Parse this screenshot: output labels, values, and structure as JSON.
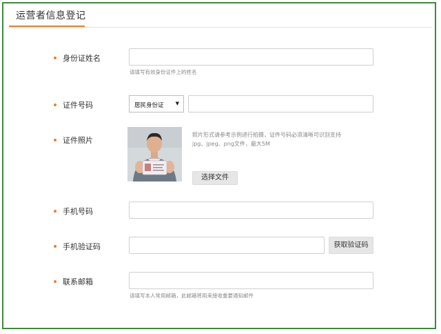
{
  "page": {
    "title": "运营者信息登记"
  },
  "colors": {
    "accent": "#e8802b",
    "frame": "#3b8a3b"
  },
  "form": {
    "id_name": {
      "label": "身份证姓名",
      "value": "",
      "hint": "请填写有效身份证件上的姓名"
    },
    "id_number": {
      "label": "证件号码",
      "type_selected": "居民身份证",
      "value": ""
    },
    "id_photo": {
      "label": "证件照片",
      "hint_line1": "照片形式请参考示例进行拍摄，证件号码必须清晰可识别支持",
      "hint_line2": "jpg、jpeg、png文件，最大5M",
      "choose_button": "选择文件"
    },
    "phone": {
      "label": "手机号码",
      "value": ""
    },
    "sms_code": {
      "label": "手机验证码",
      "value": "",
      "get_code_button": "获取验证码"
    },
    "email": {
      "label": "联系邮箱",
      "value": "",
      "hint": "请填写本人常用邮箱，此邮箱将用来接收重要通知邮件"
    }
  }
}
